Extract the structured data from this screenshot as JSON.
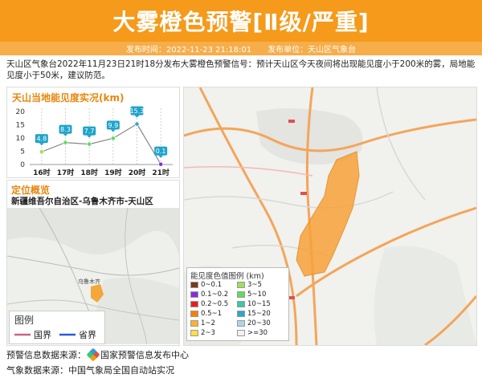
{
  "header": {
    "title": "大雾橙色预警[Ⅱ级/严重]",
    "publish_time": "发布时间：2022-11-23 21:18:01",
    "publisher": "发布单位：天山区气象台"
  },
  "description": "天山区气象台2022年11月23日21时18分发布大雾橙色预警信号：预计天山区今天夜间将出现能见度小于200米的雾，局地能见度小于50米，建议防范。",
  "visibility_chart": {
    "title": "天山当地能见度实况(km)"
  },
  "location": {
    "title": "定位概览",
    "region": "新疆维吾尔自治区-乌鲁木齐市-天山区",
    "map_city_label": "乌鲁木齐"
  },
  "map_legend": {
    "title": "图例",
    "national_border": "国界",
    "provincial_border": "省界",
    "national_color": "#c86482",
    "provincial_color": "#2a5bd7"
  },
  "visibility_legend": {
    "title": "能见度色值图例 (km)",
    "items": [
      {
        "label": "0~0.1",
        "color": "#7b3b1a"
      },
      {
        "label": "3~5",
        "color": "#9ee05a"
      },
      {
        "label": "0.1~0.2",
        "color": "#8a2be2"
      },
      {
        "label": "5~10",
        "color": "#5fdc5f"
      },
      {
        "label": "0.2~0.5",
        "color": "#e62020"
      },
      {
        "label": "10~15",
        "color": "#3cc7a8"
      },
      {
        "label": "0.5~1",
        "color": "#ff7f00"
      },
      {
        "label": "15~20",
        "color": "#2aa9c9"
      },
      {
        "label": "1~2",
        "color": "#ffb030"
      },
      {
        "label": "20~30",
        "color": "#a7d8e6"
      },
      {
        "label": "2~3",
        "color": "#ffe040"
      },
      {
        "label": ">=30",
        "color": "#f2f2f2"
      }
    ]
  },
  "footer": {
    "warning_source_label": "预警信息数据来源：",
    "warning_source": "国家预警信息发布中心",
    "weather_source": "气象数据来源：中国气象局全国自动站实况"
  },
  "chart_data": {
    "type": "line",
    "title": "天山当地能见度实况(km)",
    "categories": [
      "16时",
      "17时",
      "18时",
      "19时",
      "20时",
      "21时"
    ],
    "values": [
      4.8,
      8.3,
      7.7,
      9.9,
      15.3,
      0.1
    ],
    "y_ticks": [
      "0",
      "5",
      "10",
      "15",
      "20"
    ],
    "ylim": [
      0,
      20
    ],
    "point_colors": [
      "#9ee05a",
      "#5fdc5f",
      "#5fdc5f",
      "#5fdc5f",
      "#2aa9c9",
      "#8a2be2"
    ],
    "label_color": "#1fa3c9"
  }
}
